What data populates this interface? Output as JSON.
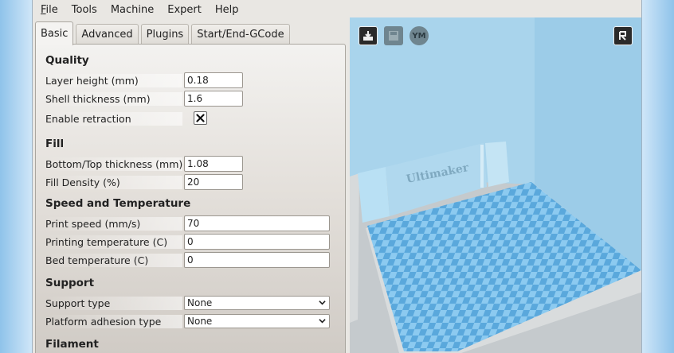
{
  "menu": [
    {
      "label": "File",
      "underline": "F",
      "rest": "ile"
    },
    {
      "label": "Tools"
    },
    {
      "label": "Machine"
    },
    {
      "label": "Expert"
    },
    {
      "label": "Help"
    }
  ],
  "tabs": [
    "Basic",
    "Advanced",
    "Plugins",
    "Start/End-GCode"
  ],
  "sections": {
    "quality": "Quality",
    "fill": "Fill",
    "speed": "Speed and Temperature",
    "support": "Support",
    "filament": "Filament"
  },
  "fields": {
    "layer_height": {
      "label": "Layer height (mm)",
      "value": "0.18"
    },
    "shell_thickness": {
      "label": "Shell thickness (mm)",
      "value": "1.6"
    },
    "enable_retraction": {
      "label": "Enable retraction",
      "checked": true
    },
    "bottom_top_thickness": {
      "label": "Bottom/Top thickness (mm)",
      "value": "1.08"
    },
    "fill_density": {
      "label": "Fill Density (%)",
      "value": "20"
    },
    "print_speed": {
      "label": "Print speed (mm/s)",
      "value": "70"
    },
    "printing_temperature": {
      "label": "Printing temperature (C)",
      "value": "0"
    },
    "bed_temperature": {
      "label": "Bed temperature (C)",
      "value": "0"
    },
    "support_type": {
      "label": "Support type",
      "value": "None"
    },
    "platform_adhesion": {
      "label": "Platform adhesion type",
      "value": "None"
    }
  },
  "viewport": {
    "bed_logo_text": "Ultimaker",
    "buttons": [
      "load-model",
      "save-gcode",
      "youmagine"
    ],
    "youmagine_label": "YM"
  },
  "colors": {
    "viewport_bg": "#8fc2de",
    "bed_light": "#8ccaf0",
    "bed_dark": "#5aa8dc"
  }
}
